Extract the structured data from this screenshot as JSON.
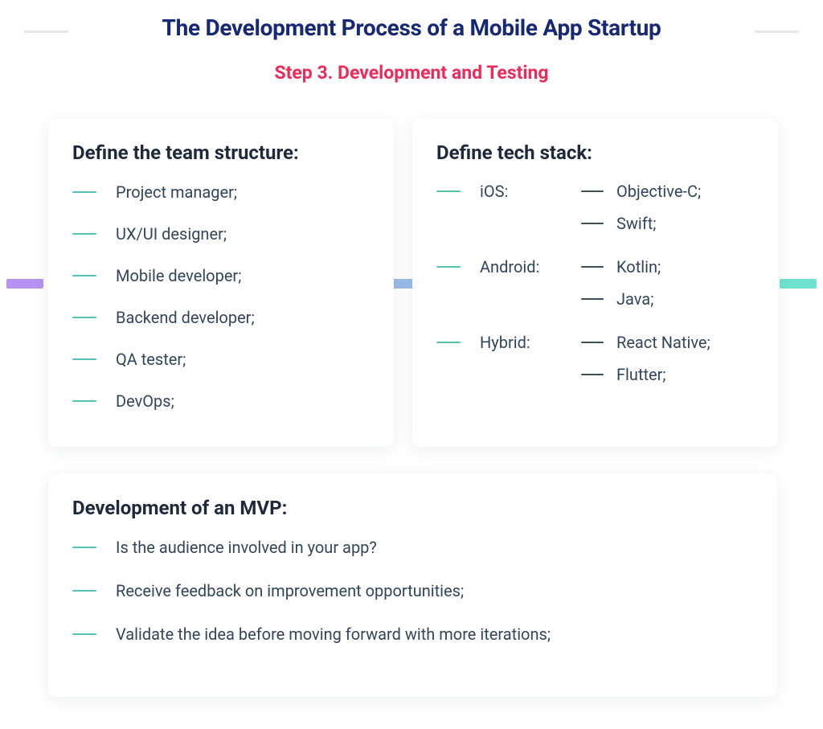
{
  "title": "The Development Process of a Mobile App Startup",
  "subtitle": "Step 3. Development and Testing",
  "team": {
    "heading": "Define the team structure:",
    "items": [
      "Project manager;",
      "UX/UI designer;",
      "Mobile developer;",
      "Backend developer;",
      "QA tester;",
      "DevOps;"
    ]
  },
  "tech": {
    "heading": "Define tech stack:",
    "rows": [
      {
        "label": "iOS:",
        "sub": [
          "Objective-C;",
          "Swift;"
        ]
      },
      {
        "label": "Android:",
        "sub": [
          "Kotlin;",
          "Java;"
        ]
      },
      {
        "label": "Hybrid:",
        "sub": [
          "React Native;",
          "Flutter;"
        ]
      }
    ]
  },
  "mvp": {
    "heading": "Development of an MVP:",
    "items": [
      "Is the audience involved in your app?",
      "Receive feedback on improvement opportunities;",
      "Validate the idea before moving forward with more iterations;"
    ]
  }
}
